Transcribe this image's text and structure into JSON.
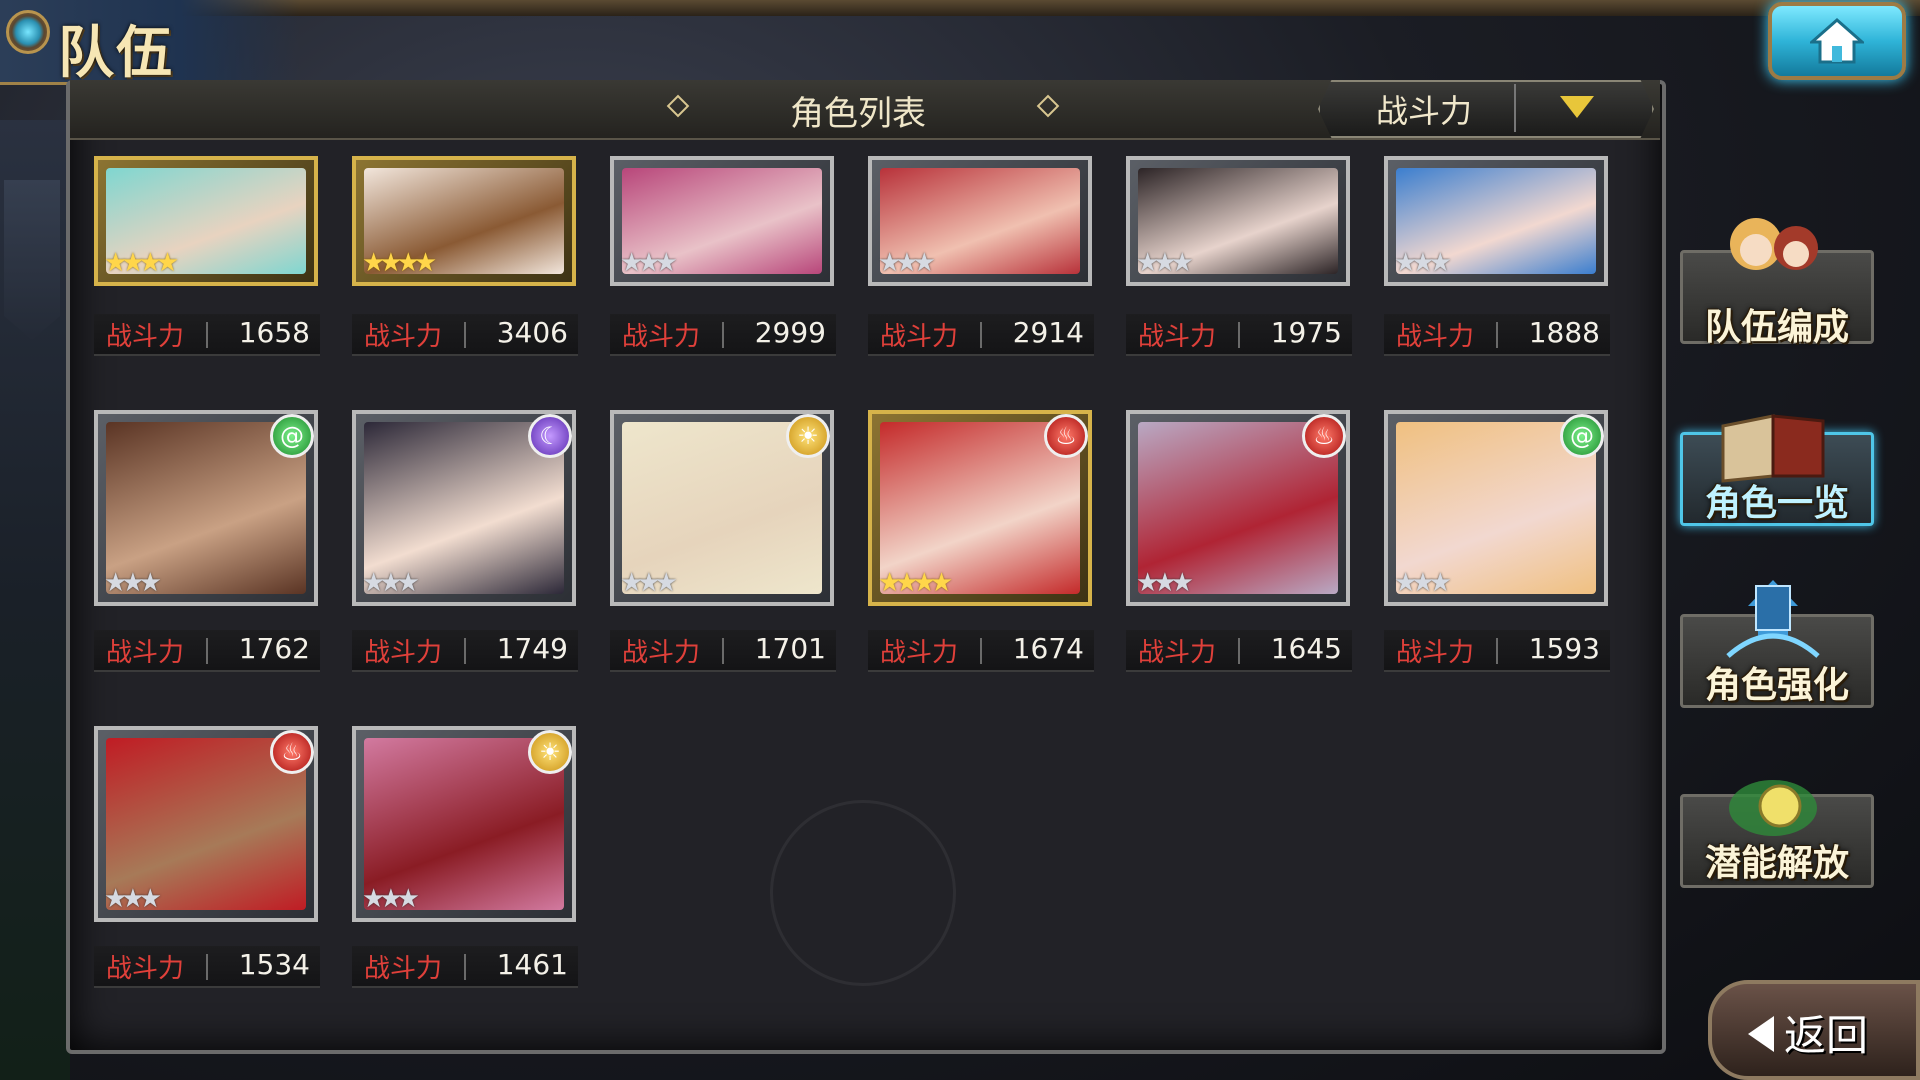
{
  "header": {
    "screen_title": "队伍",
    "list_title": "角色列表",
    "sort_label": "战斗力"
  },
  "power_label": "战斗力",
  "characters": [
    {
      "power": "1658",
      "stars": "★★★★",
      "star_color": "gold",
      "frame": "gold",
      "palette": [
        "#7fd6d0",
        "#e8d3c0"
      ]
    },
    {
      "power": "3406",
      "stars": "★★★★",
      "star_color": "gold",
      "frame": "gold",
      "palette": [
        "#f2e6dc",
        "#8a5a34"
      ]
    },
    {
      "power": "2999",
      "stars": "★★★",
      "star_color": "silver",
      "frame": "silver",
      "palette": [
        "#b8467a",
        "#e9c2c8"
      ]
    },
    {
      "power": "2914",
      "stars": "★★★",
      "star_color": "silver",
      "frame": "silver",
      "palette": [
        "#b8323a",
        "#f0c0b0"
      ]
    },
    {
      "power": "1975",
      "stars": "★★★",
      "star_color": "silver",
      "frame": "silver",
      "palette": [
        "#2c2426",
        "#e7d3cc"
      ]
    },
    {
      "power": "1888",
      "stars": "★★★",
      "star_color": "silver",
      "frame": "silver",
      "palette": [
        "#3b7ecf",
        "#f2d8d0"
      ]
    },
    {
      "power": "1762",
      "stars": "★★★",
      "star_color": "silver",
      "frame": "silver",
      "element": "wind",
      "palette": [
        "#5a3424",
        "#c9a184"
      ]
    },
    {
      "power": "1749",
      "stars": "★★★",
      "star_color": "silver",
      "frame": "silver",
      "element": "dark",
      "palette": [
        "#2c2838",
        "#f2ddd0"
      ]
    },
    {
      "power": "1701",
      "stars": "★★★",
      "star_color": "silver",
      "frame": "silver",
      "element": "light",
      "palette": [
        "#eee6cc",
        "#e6d4bc"
      ]
    },
    {
      "power": "1674",
      "stars": "★★★★",
      "star_color": "gold",
      "frame": "gold",
      "element": "fire",
      "palette": [
        "#c42a2a",
        "#f2d4c8"
      ]
    },
    {
      "power": "1645",
      "stars": "★★★",
      "star_color": "silver",
      "frame": "silver",
      "element": "fire",
      "palette": [
        "#b9a9c4",
        "#b02434"
      ]
    },
    {
      "power": "1593",
      "stars": "★★★",
      "star_color": "silver",
      "frame": "silver",
      "element": "wind",
      "palette": [
        "#f0c080",
        "#f2d8d0"
      ]
    },
    {
      "power": "1534",
      "stars": "★★★",
      "star_color": "silver",
      "frame": "silver",
      "element": "fire",
      "palette": [
        "#c01c24",
        "#a77a58"
      ]
    },
    {
      "power": "1461",
      "stars": "★★★",
      "star_color": "silver",
      "frame": "silver",
      "element": "light",
      "palette": [
        "#d27aa0",
        "#8a1c24"
      ]
    }
  ],
  "side_menu": {
    "team_formation": "队伍编成",
    "character_list": "角色一览",
    "character_enhance": "角色强化",
    "potential_release": "潜能解放"
  },
  "back_label": "返回",
  "colors": {
    "power_label": "#e0403a",
    "accent_cyan": "#4fc6e8",
    "gold": "#d6b34a"
  }
}
